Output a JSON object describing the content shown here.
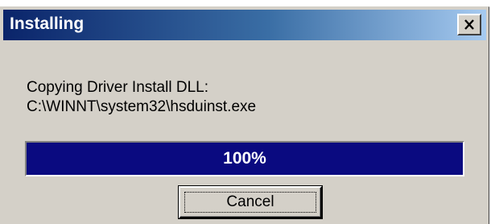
{
  "window": {
    "title": "Installing",
    "close_icon": "close-x-icon"
  },
  "message": {
    "line1": "Copying Driver Install DLL:",
    "line2": "C:\\WINNT\\system32\\hsduinst.exe"
  },
  "progress": {
    "percent": 100,
    "label": "100%"
  },
  "buttons": {
    "cancel_label": "Cancel"
  },
  "colors": {
    "title_gradient_start": "#0a246a",
    "title_gradient_end": "#a6caf0",
    "progress_fill": "#0a0a80",
    "dialog_face": "#d4d0c8"
  }
}
